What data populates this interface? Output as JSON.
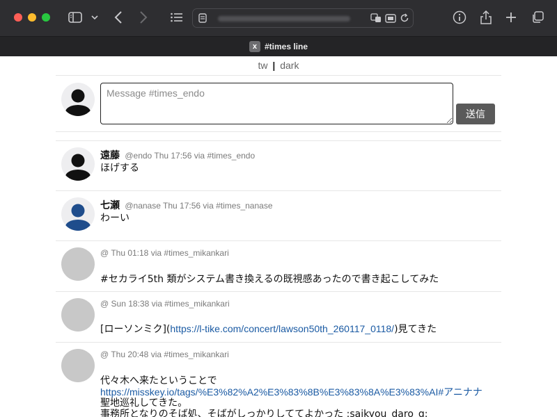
{
  "browser": {
    "tab_title": "#times line",
    "favicon_letter": "x"
  },
  "theme_links": {
    "tw": "tw",
    "separator": "|",
    "dark": "dark"
  },
  "composer": {
    "placeholder": "Message #times_endo",
    "value": "",
    "send_label": "送信"
  },
  "posts": [
    {
      "name": "遠藤",
      "handle": "@endo",
      "time": "Thu 17:56",
      "via": "via",
      "channel": "#times_endo",
      "avatar": "black-silhouette",
      "text": "ほげする"
    },
    {
      "name": "七瀬",
      "handle": "@nanase",
      "time": "Thu 17:56",
      "via": "via",
      "channel": "#times_nanase",
      "avatar": "blue-silhouette",
      "text": "わーい"
    },
    {
      "name": "",
      "handle": "@",
      "time": "Thu 01:18",
      "via": "via",
      "channel": "#times_mikankari",
      "avatar": "gray-circle",
      "text": "#セカライ5th 類がシステム書き換えるの既視感あったので書き起こしてみた"
    },
    {
      "name": "",
      "handle": "@",
      "time": "Sun 18:38",
      "via": "via",
      "channel": "#times_mikankari",
      "avatar": "gray-circle",
      "text_before": "[ローソンミク](",
      "link": "https://l-tike.com/concert/lawson50th_260117_0118/",
      "text_after": ")見てきた"
    },
    {
      "name": "",
      "handle": "@",
      "time": "Thu 20:48",
      "via": "via",
      "channel": "#times_mikankari",
      "avatar": "gray-circle",
      "line1": "代々木へ来たということで",
      "link": "https://misskey.io/tags/%E3%82%A2%E3%83%8B%E3%83%8A%E3%83%AI#アニナナ",
      "line3": "聖地巡礼してきた。",
      "line4": "事務所となりのそば処、そばがしっかりしててよかった :saikyou_daro_g:"
    }
  ],
  "colors": {
    "chrome_bg": "#2e2e31",
    "send_button": "#5a5a5a",
    "link": "#1a5aa3",
    "nanase_avatar": "#1f4d8c"
  }
}
